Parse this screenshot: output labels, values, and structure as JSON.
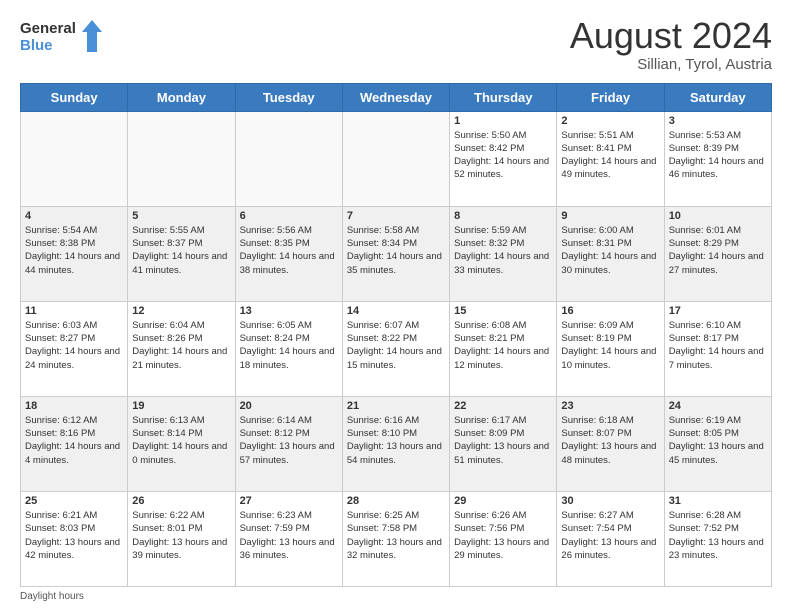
{
  "logo": {
    "line1": "General",
    "line2": "Blue"
  },
  "title": "August 2024",
  "location": "Sillian, Tyrol, Austria",
  "days_of_week": [
    "Sunday",
    "Monday",
    "Tuesday",
    "Wednesday",
    "Thursday",
    "Friday",
    "Saturday"
  ],
  "footer": "Daylight hours",
  "weeks": [
    [
      {
        "day": "",
        "info": ""
      },
      {
        "day": "",
        "info": ""
      },
      {
        "day": "",
        "info": ""
      },
      {
        "day": "",
        "info": ""
      },
      {
        "day": "1",
        "info": "Sunrise: 5:50 AM\nSunset: 8:42 PM\nDaylight: 14 hours and 52 minutes."
      },
      {
        "day": "2",
        "info": "Sunrise: 5:51 AM\nSunset: 8:41 PM\nDaylight: 14 hours and 49 minutes."
      },
      {
        "day": "3",
        "info": "Sunrise: 5:53 AM\nSunset: 8:39 PM\nDaylight: 14 hours and 46 minutes."
      }
    ],
    [
      {
        "day": "4",
        "info": "Sunrise: 5:54 AM\nSunset: 8:38 PM\nDaylight: 14 hours and 44 minutes."
      },
      {
        "day": "5",
        "info": "Sunrise: 5:55 AM\nSunset: 8:37 PM\nDaylight: 14 hours and 41 minutes."
      },
      {
        "day": "6",
        "info": "Sunrise: 5:56 AM\nSunset: 8:35 PM\nDaylight: 14 hours and 38 minutes."
      },
      {
        "day": "7",
        "info": "Sunrise: 5:58 AM\nSunset: 8:34 PM\nDaylight: 14 hours and 35 minutes."
      },
      {
        "day": "8",
        "info": "Sunrise: 5:59 AM\nSunset: 8:32 PM\nDaylight: 14 hours and 33 minutes."
      },
      {
        "day": "9",
        "info": "Sunrise: 6:00 AM\nSunset: 8:31 PM\nDaylight: 14 hours and 30 minutes."
      },
      {
        "day": "10",
        "info": "Sunrise: 6:01 AM\nSunset: 8:29 PM\nDaylight: 14 hours and 27 minutes."
      }
    ],
    [
      {
        "day": "11",
        "info": "Sunrise: 6:03 AM\nSunset: 8:27 PM\nDaylight: 14 hours and 24 minutes."
      },
      {
        "day": "12",
        "info": "Sunrise: 6:04 AM\nSunset: 8:26 PM\nDaylight: 14 hours and 21 minutes."
      },
      {
        "day": "13",
        "info": "Sunrise: 6:05 AM\nSunset: 8:24 PM\nDaylight: 14 hours and 18 minutes."
      },
      {
        "day": "14",
        "info": "Sunrise: 6:07 AM\nSunset: 8:22 PM\nDaylight: 14 hours and 15 minutes."
      },
      {
        "day": "15",
        "info": "Sunrise: 6:08 AM\nSunset: 8:21 PM\nDaylight: 14 hours and 12 minutes."
      },
      {
        "day": "16",
        "info": "Sunrise: 6:09 AM\nSunset: 8:19 PM\nDaylight: 14 hours and 10 minutes."
      },
      {
        "day": "17",
        "info": "Sunrise: 6:10 AM\nSunset: 8:17 PM\nDaylight: 14 hours and 7 minutes."
      }
    ],
    [
      {
        "day": "18",
        "info": "Sunrise: 6:12 AM\nSunset: 8:16 PM\nDaylight: 14 hours and 4 minutes."
      },
      {
        "day": "19",
        "info": "Sunrise: 6:13 AM\nSunset: 8:14 PM\nDaylight: 14 hours and 0 minutes."
      },
      {
        "day": "20",
        "info": "Sunrise: 6:14 AM\nSunset: 8:12 PM\nDaylight: 13 hours and 57 minutes."
      },
      {
        "day": "21",
        "info": "Sunrise: 6:16 AM\nSunset: 8:10 PM\nDaylight: 13 hours and 54 minutes."
      },
      {
        "day": "22",
        "info": "Sunrise: 6:17 AM\nSunset: 8:09 PM\nDaylight: 13 hours and 51 minutes."
      },
      {
        "day": "23",
        "info": "Sunrise: 6:18 AM\nSunset: 8:07 PM\nDaylight: 13 hours and 48 minutes."
      },
      {
        "day": "24",
        "info": "Sunrise: 6:19 AM\nSunset: 8:05 PM\nDaylight: 13 hours and 45 minutes."
      }
    ],
    [
      {
        "day": "25",
        "info": "Sunrise: 6:21 AM\nSunset: 8:03 PM\nDaylight: 13 hours and 42 minutes."
      },
      {
        "day": "26",
        "info": "Sunrise: 6:22 AM\nSunset: 8:01 PM\nDaylight: 13 hours and 39 minutes."
      },
      {
        "day": "27",
        "info": "Sunrise: 6:23 AM\nSunset: 7:59 PM\nDaylight: 13 hours and 36 minutes."
      },
      {
        "day": "28",
        "info": "Sunrise: 6:25 AM\nSunset: 7:58 PM\nDaylight: 13 hours and 32 minutes."
      },
      {
        "day": "29",
        "info": "Sunrise: 6:26 AM\nSunset: 7:56 PM\nDaylight: 13 hours and 29 minutes."
      },
      {
        "day": "30",
        "info": "Sunrise: 6:27 AM\nSunset: 7:54 PM\nDaylight: 13 hours and 26 minutes."
      },
      {
        "day": "31",
        "info": "Sunrise: 6:28 AM\nSunset: 7:52 PM\nDaylight: 13 hours and 23 minutes."
      }
    ]
  ]
}
